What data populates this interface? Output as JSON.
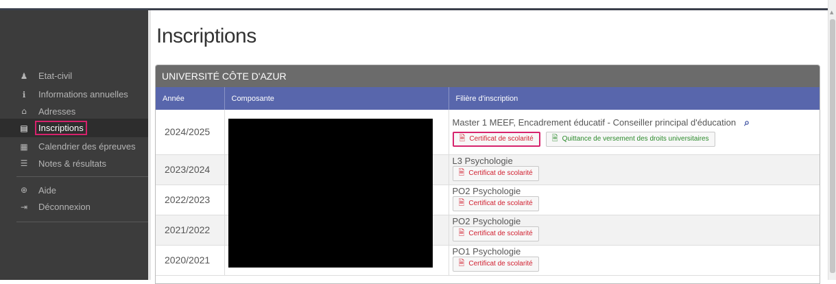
{
  "sidebar": {
    "items": [
      {
        "label": "Etat-civil",
        "icon": "user-icon",
        "glyph": "♟"
      },
      {
        "label": "Informations annuelles",
        "icon": "info-icon",
        "glyph": "ℹ"
      },
      {
        "label": "Adresses",
        "icon": "home-icon",
        "glyph": "⌂"
      },
      {
        "label": "Inscriptions",
        "icon": "file-icon",
        "glyph": "▤",
        "active": true
      },
      {
        "label": "Calendrier des épreuves",
        "icon": "calendar-icon",
        "glyph": "▦"
      },
      {
        "label": "Notes & résultats",
        "icon": "list-icon",
        "glyph": "☰"
      },
      {
        "label": "Aide",
        "icon": "help-icon",
        "glyph": "⊕"
      },
      {
        "label": "Déconnexion",
        "icon": "logout-icon",
        "glyph": "⇥"
      }
    ]
  },
  "page": {
    "title": "Inscriptions"
  },
  "panel": {
    "title": "UNIVERSITÉ CÔTE D'AZUR",
    "columns": [
      "Année",
      "Composante",
      "Filière d'inscription"
    ],
    "rows": [
      {
        "year": "2024/2025",
        "filiere": "Master 1 MEEF, Encadrement éducatif - Conseiller principal d'éducation",
        "cert": "Certificat de scolarité",
        "quittance": "Quittance de versement des droits universitaires"
      },
      {
        "year": "2023/2024",
        "filiere": "L3 Psychologie",
        "cert": "Certificat de scolarité"
      },
      {
        "year": "2022/2023",
        "filiere": "PO2 Psychologie",
        "cert": "Certificat de scolarité"
      },
      {
        "year": "2021/2022",
        "filiere": "PO2 Psychologie",
        "cert": "Certificat de scolarité"
      },
      {
        "year": "2020/2021",
        "filiere": "PO1 Psychologie",
        "cert": "Certificat de scolarité"
      }
    ]
  },
  "colors": {
    "header_bg": "#5866ac",
    "panel_head": "#6b6b6b",
    "sidebar_bg": "#3c3c3c",
    "highlight": "#d6226c",
    "cert_text": "#d11f2f",
    "quittance_text": "#2a8a2a"
  }
}
